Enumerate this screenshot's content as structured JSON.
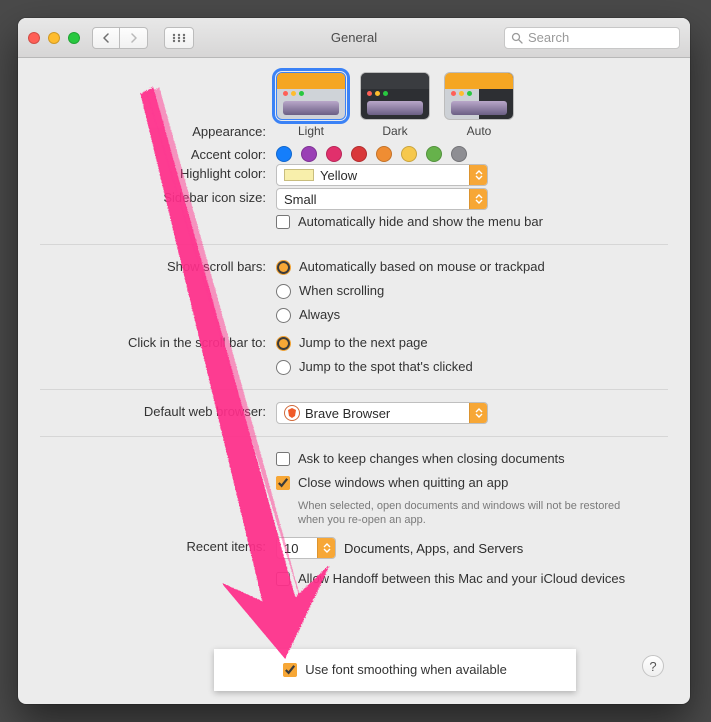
{
  "window": {
    "title": "General"
  },
  "search": {
    "placeholder": "Search"
  },
  "appearance": {
    "label": "Appearance:",
    "options": [
      "Light",
      "Dark",
      "Auto"
    ],
    "selected": "Light"
  },
  "accent": {
    "label": "Accent color:",
    "colors": [
      "#157efb",
      "#9a3fb5",
      "#e1306c",
      "#d9383a",
      "#ef8d33",
      "#f6c84c",
      "#66b24b",
      "#8e8e93"
    ]
  },
  "highlight": {
    "label": "Highlight color:",
    "value": "Yellow"
  },
  "sidebar_size": {
    "label": "Sidebar icon size:",
    "value": "Small"
  },
  "menubar_autohide": {
    "label": "Automatically hide and show the menu bar",
    "checked": false
  },
  "scrollbars": {
    "label": "Show scroll bars:",
    "options": [
      "Automatically based on mouse or trackpad",
      "When scrolling",
      "Always"
    ],
    "selected_index": 0
  },
  "click_scrollbar": {
    "label": "Click in the scroll bar to:",
    "options": [
      "Jump to the next page",
      "Jump to the spot that's clicked"
    ],
    "selected_index": 0
  },
  "default_browser": {
    "label": "Default web browser:",
    "value": "Brave Browser"
  },
  "ask_keep_changes": {
    "label": "Ask to keep changes when closing documents",
    "checked": false
  },
  "close_windows": {
    "label": "Close windows when quitting an app",
    "checked": true,
    "note": "When selected, open documents and windows will not be restored when you re-open an app."
  },
  "recent_items": {
    "label": "Recent items:",
    "value": "10",
    "suffix": "Documents, Apps, and Servers"
  },
  "handoff": {
    "label": "Allow Handoff between this Mac and your iCloud devices",
    "checked": false
  },
  "font_smoothing": {
    "label": "Use font smoothing when available",
    "checked": true
  }
}
